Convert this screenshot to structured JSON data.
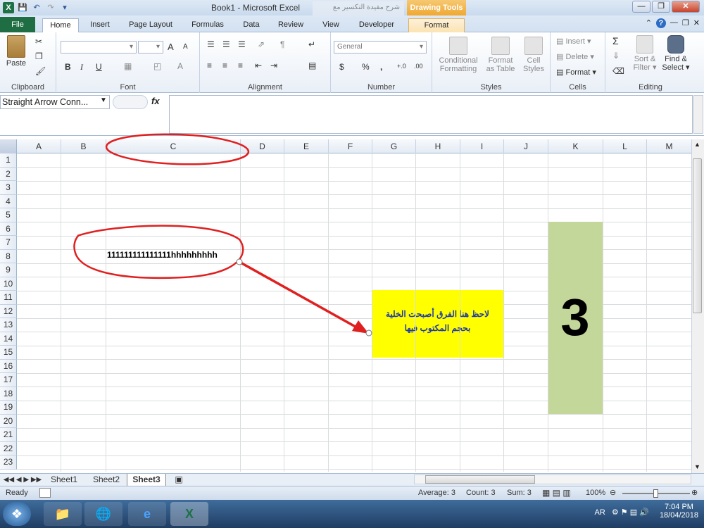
{
  "window": {
    "title": "Book1  -  Microsoft Excel",
    "ghost_tab": "شرح مفيدة التكسير مع",
    "context_tab_group": "Drawing Tools"
  },
  "ribbon_tabs": [
    "File",
    "Home",
    "Insert",
    "Page Layout",
    "Formulas",
    "Data",
    "Review",
    "View",
    "Developer",
    "Format"
  ],
  "ribbon": {
    "clipboard": {
      "label": "Clipboard",
      "paste": "Paste"
    },
    "font": {
      "label": "Font",
      "bold": "B",
      "italic": "I",
      "underline": "U",
      "grow": "A",
      "shrink": "A"
    },
    "alignment": {
      "label": "Alignment"
    },
    "number": {
      "label": "Number",
      "format": "General",
      "currency": "$",
      "percent": "%",
      "comma": ",",
      "inc_dec": "+.0",
      "dec_dec": ".00"
    },
    "styles": {
      "label": "Styles",
      "conditional": "Conditional",
      "conditional2": "Formatting",
      "format_table": "Format",
      "format_table2": "as Table",
      "cell_styles": "Cell",
      "cell_styles2": "Styles"
    },
    "cells": {
      "label": "Cells",
      "insert": "Insert",
      "delete": "Delete",
      "format": "Format"
    },
    "editing": {
      "label": "Editing",
      "sigma": "Σ",
      "sort": "Sort &",
      "sort2": "Filter",
      "find": "Find &",
      "find2": "Select"
    }
  },
  "formula_bar": {
    "name_box": "Straight Arrow Conn...",
    "fx": "fx",
    "value": ""
  },
  "columns": [
    "A",
    "B",
    "C",
    "D",
    "E",
    "F",
    "G",
    "H",
    "I",
    "J",
    "K",
    "L",
    "M"
  ],
  "rows": [
    "1",
    "2",
    "3",
    "4",
    "5",
    "6",
    "7",
    "8",
    "9",
    "10",
    "11",
    "12",
    "13",
    "14",
    "15",
    "16",
    "17",
    "18",
    "19",
    "20",
    "21",
    "22",
    "23"
  ],
  "cells": {
    "C8": "111111111111111hhhhhhhhh"
  },
  "shapes": {
    "yellow_note_line1": "لاحظ هنا الفرق أصبحت الخلية",
    "yellow_note_line2": "بحجم المكتوب فيها",
    "green_box_text": "3"
  },
  "sheet_tabs": [
    "Sheet1",
    "Sheet2",
    "Sheet3"
  ],
  "active_sheet": "Sheet3",
  "status_bar": {
    "ready": "Ready",
    "average": "Average: 3",
    "count": "Count: 3",
    "sum": "Sum: 3",
    "zoom": "100%"
  },
  "taskbar": {
    "lang": "AR",
    "time": "7:04 PM",
    "date": "18/04/2018"
  },
  "colors": {
    "accent_file": "#1f6e43",
    "annotation_red": "#e02020",
    "yellow_fill": "#ffff00",
    "green_fill": "#c4d79b",
    "drawing_tools": "#f0a830"
  }
}
